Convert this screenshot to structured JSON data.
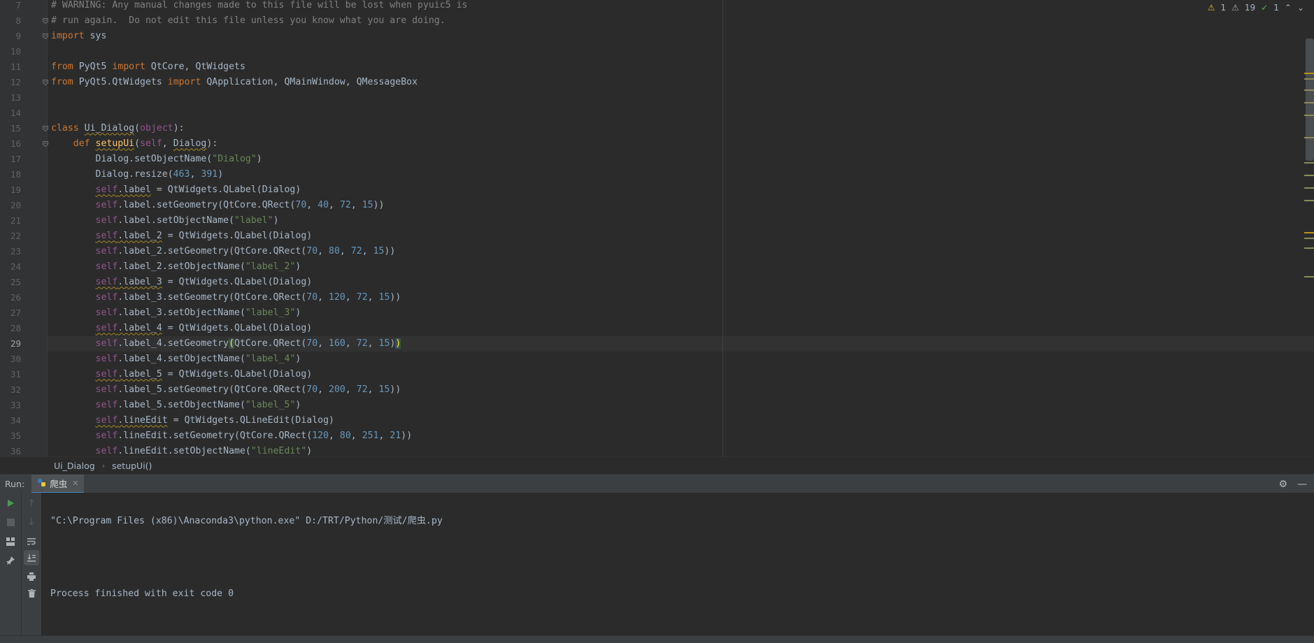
{
  "editor": {
    "inspections": {
      "warnings": "1",
      "weak_warnings": "19",
      "ok": "1"
    },
    "lines": [
      {
        "n": "7",
        "tokens": [
          [
            "comment",
            "# WARNING: Any manual changes made to this file will be lost when pyuic5 is"
          ]
        ]
      },
      {
        "n": "8",
        "fold": true,
        "tokens": [
          [
            "comment",
            "# run again.  Do not edit this file unless you know what you are doing."
          ]
        ]
      },
      {
        "n": "9",
        "fold": true,
        "tokens": [
          [
            "kw",
            "import"
          ],
          [
            "",
            " sys"
          ]
        ]
      },
      {
        "n": "10",
        "tokens": []
      },
      {
        "n": "11",
        "tokens": [
          [
            "kw",
            "from"
          ],
          [
            "",
            " PyQt5 "
          ],
          [
            "kw",
            "import"
          ],
          [
            "",
            " QtCore, QtWidgets"
          ]
        ]
      },
      {
        "n": "12",
        "fold": true,
        "tokens": [
          [
            "kw",
            "from"
          ],
          [
            "",
            " PyQt5.QtWidgets "
          ],
          [
            "kw",
            "import"
          ],
          [
            "",
            " QApplication, QMainWindow, QMessageBox"
          ]
        ]
      },
      {
        "n": "13",
        "tokens": []
      },
      {
        "n": "14",
        "tokens": []
      },
      {
        "n": "15",
        "fold": true,
        "tokens": [
          [
            "kw",
            "class"
          ],
          [
            "",
            " "
          ],
          [
            "squig",
            "Ui_Dialog"
          ],
          [
            "",
            "("
          ],
          [
            "self",
            "object"
          ],
          [
            "",
            "):"
          ]
        ]
      },
      {
        "n": "16",
        "fold": true,
        "tokens": [
          [
            "",
            "    "
          ],
          [
            "kw",
            "def"
          ],
          [
            "",
            " "
          ],
          [
            "fn squig",
            "setupUi"
          ],
          [
            "",
            "("
          ],
          [
            "self",
            "self"
          ],
          [
            "",
            ", "
          ],
          [
            "squig",
            "Dialog"
          ],
          [
            "",
            "):"
          ]
        ]
      },
      {
        "n": "17",
        "tokens": [
          [
            "",
            "        Dialog.setObjectName("
          ],
          [
            "str",
            "\"Dialog\""
          ],
          [
            "",
            ")"
          ]
        ]
      },
      {
        "n": "18",
        "tokens": [
          [
            "",
            "        Dialog.resize("
          ],
          [
            "num",
            "463"
          ],
          [
            "",
            ", "
          ],
          [
            "num",
            "391"
          ],
          [
            "",
            ")"
          ]
        ]
      },
      {
        "n": "19",
        "tokens": [
          [
            "",
            "        "
          ],
          [
            "self squig",
            "self"
          ],
          [
            "squig",
            ".label"
          ],
          [
            "",
            " = QtWidgets.QLabel(Dialog)"
          ]
        ]
      },
      {
        "n": "20",
        "tokens": [
          [
            "",
            "        "
          ],
          [
            "self",
            "self"
          ],
          [
            "",
            ".label.setGeometry(QtCore.QRect("
          ],
          [
            "num",
            "70"
          ],
          [
            "",
            ", "
          ],
          [
            "num",
            "40"
          ],
          [
            "",
            ", "
          ],
          [
            "num",
            "72"
          ],
          [
            "",
            ", "
          ],
          [
            "num",
            "15"
          ],
          [
            "",
            "))"
          ]
        ]
      },
      {
        "n": "21",
        "tokens": [
          [
            "",
            "        "
          ],
          [
            "self",
            "self"
          ],
          [
            "",
            ".label.setObjectName("
          ],
          [
            "str",
            "\"label\""
          ],
          [
            "",
            ")"
          ]
        ]
      },
      {
        "n": "22",
        "tokens": [
          [
            "",
            "        "
          ],
          [
            "self squig",
            "self"
          ],
          [
            "squig",
            ".label_2"
          ],
          [
            "",
            " = QtWidgets.QLabel(Dialog)"
          ]
        ]
      },
      {
        "n": "23",
        "tokens": [
          [
            "",
            "        "
          ],
          [
            "self",
            "self"
          ],
          [
            "",
            ".label_2.setGeometry(QtCore.QRect("
          ],
          [
            "num",
            "70"
          ],
          [
            "",
            ", "
          ],
          [
            "num",
            "80"
          ],
          [
            "",
            ", "
          ],
          [
            "num",
            "72"
          ],
          [
            "",
            ", "
          ],
          [
            "num",
            "15"
          ],
          [
            "",
            "))"
          ]
        ]
      },
      {
        "n": "24",
        "tokens": [
          [
            "",
            "        "
          ],
          [
            "self",
            "self"
          ],
          [
            "",
            ".label_2.setObjectName("
          ],
          [
            "str",
            "\"label_2\""
          ],
          [
            "",
            ")"
          ]
        ]
      },
      {
        "n": "25",
        "tokens": [
          [
            "",
            "        "
          ],
          [
            "self squig",
            "self"
          ],
          [
            "squig",
            ".label_3"
          ],
          [
            "",
            " = QtWidgets.QLabel(Dialog)"
          ]
        ]
      },
      {
        "n": "26",
        "tokens": [
          [
            "",
            "        "
          ],
          [
            "self",
            "self"
          ],
          [
            "",
            ".label_3.setGeometry(QtCore.QRect("
          ],
          [
            "num",
            "70"
          ],
          [
            "",
            ", "
          ],
          [
            "num",
            "120"
          ],
          [
            "",
            ", "
          ],
          [
            "num",
            "72"
          ],
          [
            "",
            ", "
          ],
          [
            "num",
            "15"
          ],
          [
            "",
            "))"
          ]
        ]
      },
      {
        "n": "27",
        "tokens": [
          [
            "",
            "        "
          ],
          [
            "self",
            "self"
          ],
          [
            "",
            ".label_3.setObjectName("
          ],
          [
            "str",
            "\"label_3\""
          ],
          [
            "",
            ")"
          ]
        ]
      },
      {
        "n": "28",
        "tokens": [
          [
            "",
            "        "
          ],
          [
            "self squig",
            "self"
          ],
          [
            "squig",
            ".label_4"
          ],
          [
            "",
            " = QtWidgets.QLabel(Dialog)"
          ]
        ]
      },
      {
        "n": "29",
        "current": true,
        "tokens": [
          [
            "",
            "        "
          ],
          [
            "self",
            "self"
          ],
          [
            "",
            ".label_4.setGeometry"
          ],
          [
            "bracket",
            "("
          ],
          [
            "",
            "QtCore.QRect("
          ],
          [
            "num",
            "70"
          ],
          [
            "",
            ", "
          ],
          [
            "num",
            "160"
          ],
          [
            "",
            ", "
          ],
          [
            "num",
            "72"
          ],
          [
            "",
            ", "
          ],
          [
            "num",
            "15"
          ],
          [
            "",
            ")"
          ],
          [
            "bracket",
            ")"
          ]
        ]
      },
      {
        "n": "30",
        "tokens": [
          [
            "",
            "        "
          ],
          [
            "self",
            "self"
          ],
          [
            "",
            ".label_4.setObjectName("
          ],
          [
            "str",
            "\"label_4\""
          ],
          [
            "",
            ")"
          ]
        ]
      },
      {
        "n": "31",
        "tokens": [
          [
            "",
            "        "
          ],
          [
            "self squig",
            "self"
          ],
          [
            "squig",
            ".label_5"
          ],
          [
            "",
            " = QtWidgets.QLabel(Dialog)"
          ]
        ]
      },
      {
        "n": "32",
        "tokens": [
          [
            "",
            "        "
          ],
          [
            "self",
            "self"
          ],
          [
            "",
            ".label_5.setGeometry(QtCore.QRect("
          ],
          [
            "num",
            "70"
          ],
          [
            "",
            ", "
          ],
          [
            "num",
            "200"
          ],
          [
            "",
            ", "
          ],
          [
            "num",
            "72"
          ],
          [
            "",
            ", "
          ],
          [
            "num",
            "15"
          ],
          [
            "",
            "))"
          ]
        ]
      },
      {
        "n": "33",
        "tokens": [
          [
            "",
            "        "
          ],
          [
            "self",
            "self"
          ],
          [
            "",
            ".label_5.setObjectName("
          ],
          [
            "str",
            "\"label_5\""
          ],
          [
            "",
            ")"
          ]
        ]
      },
      {
        "n": "34",
        "tokens": [
          [
            "",
            "        "
          ],
          [
            "self squig",
            "self"
          ],
          [
            "squig",
            ".lineEdit"
          ],
          [
            "",
            " = QtWidgets.QLineEdit(Dialog)"
          ]
        ]
      },
      {
        "n": "35",
        "tokens": [
          [
            "",
            "        "
          ],
          [
            "self",
            "self"
          ],
          [
            "",
            ".lineEdit.setGeometry(QtCore.QRect("
          ],
          [
            "num",
            "120"
          ],
          [
            "",
            ", "
          ],
          [
            "num",
            "80"
          ],
          [
            "",
            ", "
          ],
          [
            "num",
            "251"
          ],
          [
            "",
            ", "
          ],
          [
            "num",
            "21"
          ],
          [
            "",
            "))"
          ]
        ]
      },
      {
        "n": "36",
        "tokens": [
          [
            "",
            "        "
          ],
          [
            "self",
            "self"
          ],
          [
            "",
            ".lineEdit.setObjectName("
          ],
          [
            "str",
            "\"lineEdit\""
          ],
          [
            "",
            ")"
          ]
        ]
      }
    ]
  },
  "breadcrumb": {
    "class_name": "Ui_Dialog",
    "method_name": "setupUi()"
  },
  "run": {
    "label": "Run:",
    "tab_label": "爬虫",
    "console": [
      "\"C:\\Program Files (x86)\\Anaconda3\\python.exe\" D:/TRT/Python/测试/爬虫.py",
      "",
      "Process finished with exit code 0"
    ]
  },
  "colors": {
    "editor_bg": "#2b2b2b",
    "keyword": "#cc7832",
    "string": "#6a8759",
    "number": "#6897bb",
    "self": "#94558d",
    "comment": "#808080",
    "function": "#ffc66d"
  },
  "icons": [
    "warning-icon",
    "weak-warning-icon",
    "ok-check-icon",
    "python-file-icon",
    "run-icon",
    "stop-icon",
    "gear-icon",
    "minimize-icon"
  ]
}
